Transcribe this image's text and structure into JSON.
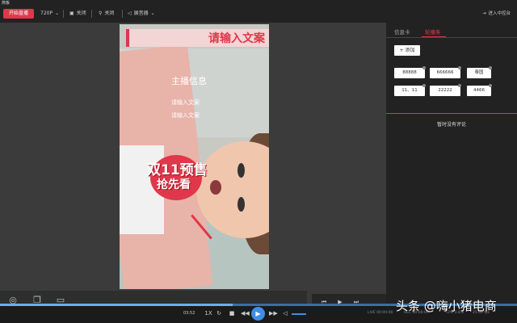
{
  "topbar": {
    "title": "简板",
    "start_label": "开始直播",
    "resolution": "720P",
    "camera": "关闭",
    "search": "关闭",
    "speaker": "展音器",
    "exit": "进入中控台"
  },
  "phone": {
    "banner": "请输入文案",
    "info_title": "主播信息",
    "info_lines": [
      "请输入文案",
      "请输入文案"
    ],
    "promo_line1": "双11预售",
    "promo_line2": "抢先看"
  },
  "right": {
    "tabs": [
      "信息卡",
      "轮播条"
    ],
    "add_label": "+ 添加",
    "chips": [
      "88888",
      "666666",
      "泰国",
      "11、11",
      "22222",
      "4466"
    ],
    "empty_comments": "暂时没有评论"
  },
  "player": {
    "time": "03:52",
    "speed": "1X",
    "progress": 0.45,
    "stats": [
      "LIVE 00:00:00",
      "REC 00:00:00",
      "CPU 3.8%",
      "25.00 fps"
    ]
  },
  "watermark": "头条 @嗨小猪电商",
  "colors": {
    "accent": "#e0374a",
    "play": "#3d8ee6"
  },
  "icons": [
    "monitor-icon",
    "camera-icon",
    "search-icon",
    "speaker-icon",
    "exit-icon",
    "play-icon",
    "stop-icon",
    "previous-icon",
    "next-icon",
    "volume-icon"
  ]
}
